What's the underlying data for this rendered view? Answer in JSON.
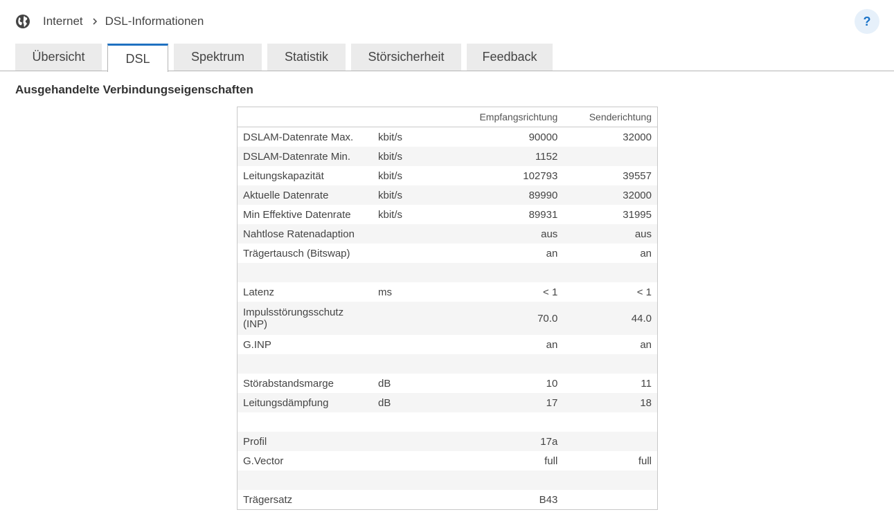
{
  "breadcrumb": {
    "home": "Internet",
    "current": "DSL-Informationen"
  },
  "help": {
    "label": "?"
  },
  "tabs": [
    {
      "label": "Übersicht",
      "active": false
    },
    {
      "label": "DSL",
      "active": true
    },
    {
      "label": "Spektrum",
      "active": false
    },
    {
      "label": "Statistik",
      "active": false
    },
    {
      "label": "Störsicherheit",
      "active": false
    },
    {
      "label": "Feedback",
      "active": false
    }
  ],
  "section": {
    "title": "Ausgehandelte Verbindungseigenschaften"
  },
  "table": {
    "headers": [
      "",
      "",
      "Empfangsrichtung",
      "Senderichtung"
    ],
    "rows": [
      {
        "label": "DSLAM-Datenrate Max.",
        "unit": "kbit/s",
        "down": "90000",
        "up": "32000"
      },
      {
        "label": "DSLAM-Datenrate Min.",
        "unit": "kbit/s",
        "down": "1152",
        "up": ""
      },
      {
        "label": "Leitungskapazität",
        "unit": "kbit/s",
        "down": "102793",
        "up": "39557"
      },
      {
        "label": "Aktuelle Datenrate",
        "unit": "kbit/s",
        "down": "89990",
        "up": "32000"
      },
      {
        "label": "Min Effektive Datenrate",
        "unit": "kbit/s",
        "down": "89931",
        "up": "31995"
      },
      {
        "label": "Nahtlose Ratenadaption",
        "unit": "",
        "down": "aus",
        "up": "aus"
      },
      {
        "label": "Trägertausch (Bitswap)",
        "unit": "",
        "down": "an",
        "up": "an"
      },
      {
        "label": "",
        "unit": "",
        "down": "",
        "up": ""
      },
      {
        "label": "Latenz",
        "unit": "ms",
        "down": "< 1",
        "up": "< 1"
      },
      {
        "label": "Impulsstörungsschutz (INP)",
        "unit": "",
        "down": "70.0",
        "up": "44.0",
        "tall": true
      },
      {
        "label": "G.INP",
        "unit": "",
        "down": "an",
        "up": "an"
      },
      {
        "label": "",
        "unit": "",
        "down": "",
        "up": ""
      },
      {
        "label": "Störabstandsmarge",
        "unit": "dB",
        "down": "10",
        "up": "11"
      },
      {
        "label": "Leitungsdämpfung",
        "unit": "dB",
        "down": "17",
        "up": "18"
      },
      {
        "label": "",
        "unit": "",
        "down": "",
        "up": ""
      },
      {
        "label": "Profil",
        "unit": "",
        "down": "17a",
        "up": ""
      },
      {
        "label": "G.Vector",
        "unit": "",
        "down": "full",
        "up": "full"
      },
      {
        "label": "",
        "unit": "",
        "down": "",
        "up": ""
      },
      {
        "label": "Trägersatz",
        "unit": "",
        "down": "B43",
        "up": ""
      }
    ]
  },
  "colors": {
    "accent": "#1f71c1",
    "tab_inactive": "#ebebeb",
    "row_alt": "#f5f5f5",
    "help_bg": "#e6f0fa"
  },
  "icons": {
    "globe": "globe-icon",
    "breadcrumb_separator": "chevron-right-icon"
  }
}
